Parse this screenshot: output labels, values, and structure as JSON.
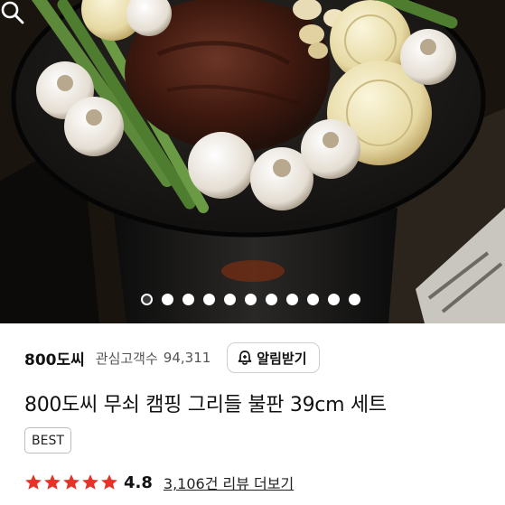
{
  "gallery": {
    "image_alt_icon": "grilled-steak-photo",
    "page_count": 11,
    "active_index": 0,
    "zoom_icon": "search-icon"
  },
  "seller": {
    "name": "800도씨",
    "interest_label": "관심고객수",
    "interest_count": "94,311",
    "notify_label": "알림받기",
    "notify_icon": "bell-plus-icon"
  },
  "product": {
    "title": "800도씨 무쇠 캠핑 그리들 불판 39cm 세트",
    "badge": "BEST"
  },
  "rating": {
    "score": "4.8",
    "stars": 5,
    "star_color": "#e5332a",
    "reviews_link": "3,106건 리뷰 더보기"
  }
}
